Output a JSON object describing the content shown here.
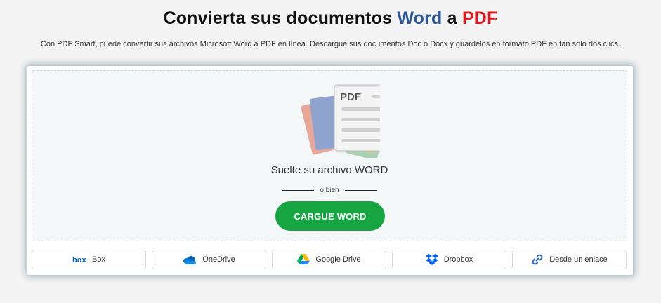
{
  "header": {
    "title_prefix": "Convierta sus documentos ",
    "title_word": "Word",
    "title_mid": " a ",
    "title_pdf": "PDF",
    "subtitle": "Con PDF Smart, puede convertir sus archivos Microsoft Word a PDF en línea. Descargue sus documentos Doc o Docx y guárdelos en formato PDF en tan solo dos clics."
  },
  "dropzone": {
    "illustration_label": "PDF",
    "drop_text": "Suelte su archivo WORD",
    "or_text": "o bien",
    "upload_label": "CARGUE WORD"
  },
  "sources": [
    {
      "label": "Box",
      "icon": "box-icon"
    },
    {
      "label": "OneDrive",
      "icon": "onedrive-icon"
    },
    {
      "label": "Google Drive",
      "icon": "google-drive-icon"
    },
    {
      "label": "Dropbox",
      "icon": "dropbox-icon"
    },
    {
      "label": "Desde un enlace",
      "icon": "link-icon"
    }
  ],
  "colors": {
    "word_blue": "#2b579a",
    "pdf_red": "#e3161b",
    "upload_green": "#16a541"
  }
}
